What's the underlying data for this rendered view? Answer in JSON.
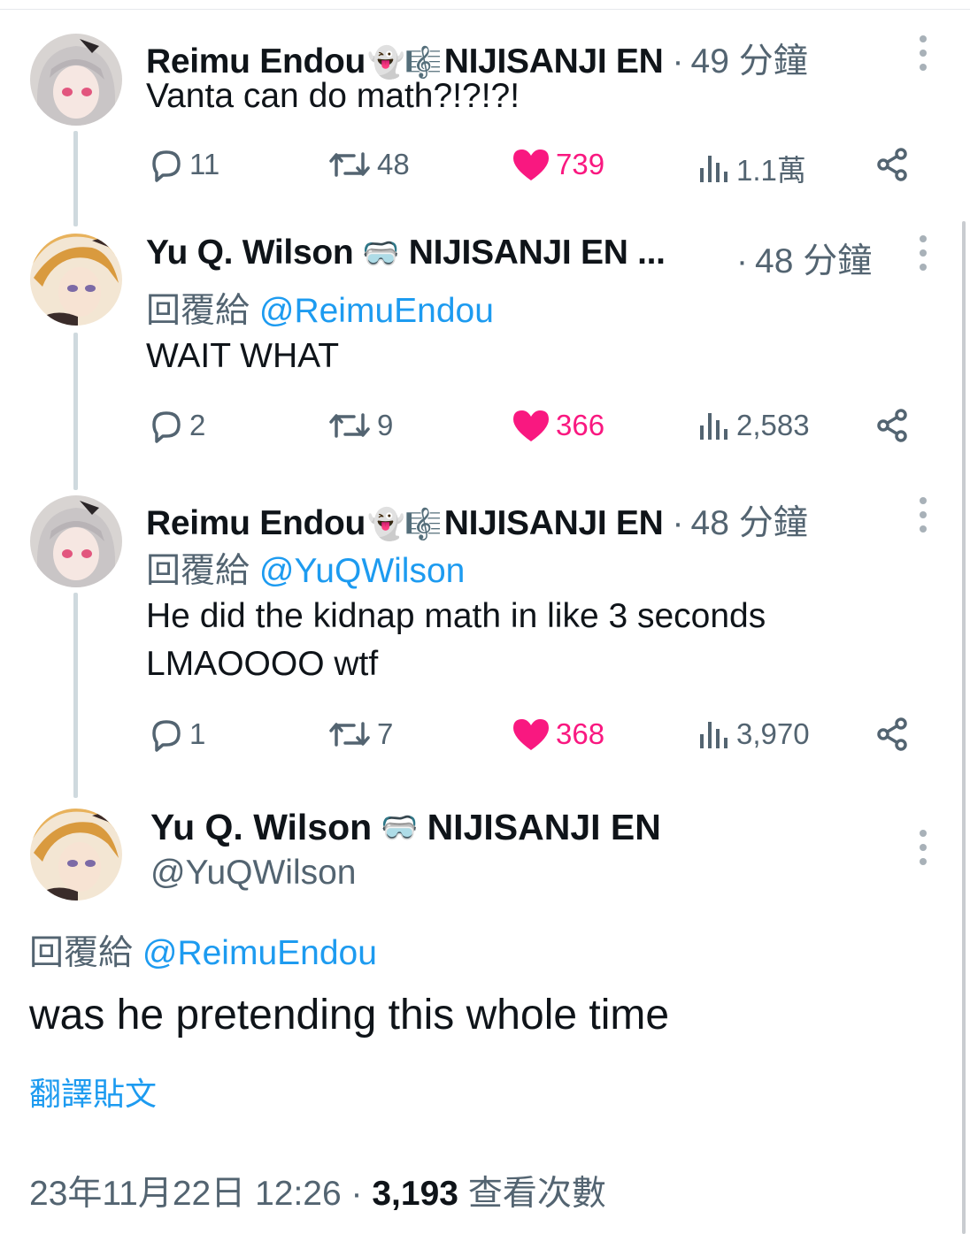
{
  "tweets": [
    {
      "name": "Reimu Endou",
      "badge": "👻🎼",
      "org": "NIJISANJI EN",
      "time": "49 分鐘",
      "text": "Vanta can do math?!?!?!",
      "replies": "11",
      "retweets": "48",
      "likes": "739",
      "views": "1.1萬"
    },
    {
      "name": "Yu Q. Wilson",
      "badge": "🥽",
      "org": "NIJISANJI EN ...",
      "time": "48 分鐘",
      "reply_prefix": "回覆給",
      "reply_to": "@ReimuEndou",
      "text": "WAIT WHAT",
      "replies": "2",
      "retweets": "9",
      "likes": "366",
      "views": "2,583"
    },
    {
      "name": "Reimu Endou",
      "badge": "👻🎼",
      "org": "NIJISANJI EN",
      "time": "48 分鐘",
      "reply_prefix": "回覆給",
      "reply_to": "@YuQWilson",
      "text_line1": "He did the kidnap math in like 3 seconds",
      "text_line2": "LMAOOOO wtf",
      "replies": "1",
      "retweets": "7",
      "likes": "368",
      "views": "3,970"
    }
  ],
  "focus": {
    "name": "Yu Q. Wilson",
    "badge": "🥽",
    "org": "NIJISANJI EN",
    "handle": "@YuQWilson",
    "reply_prefix": "回覆給",
    "reply_to": "@ReimuEndou",
    "text": "was he pretending this whole time",
    "translate": "翻譯貼文",
    "date": "23年11月22日 12:26",
    "views": "3,193",
    "views_label": "查看次數"
  },
  "colors": {
    "link": "#1d9bf0",
    "like": "#f91880",
    "secondary": "#536471"
  }
}
